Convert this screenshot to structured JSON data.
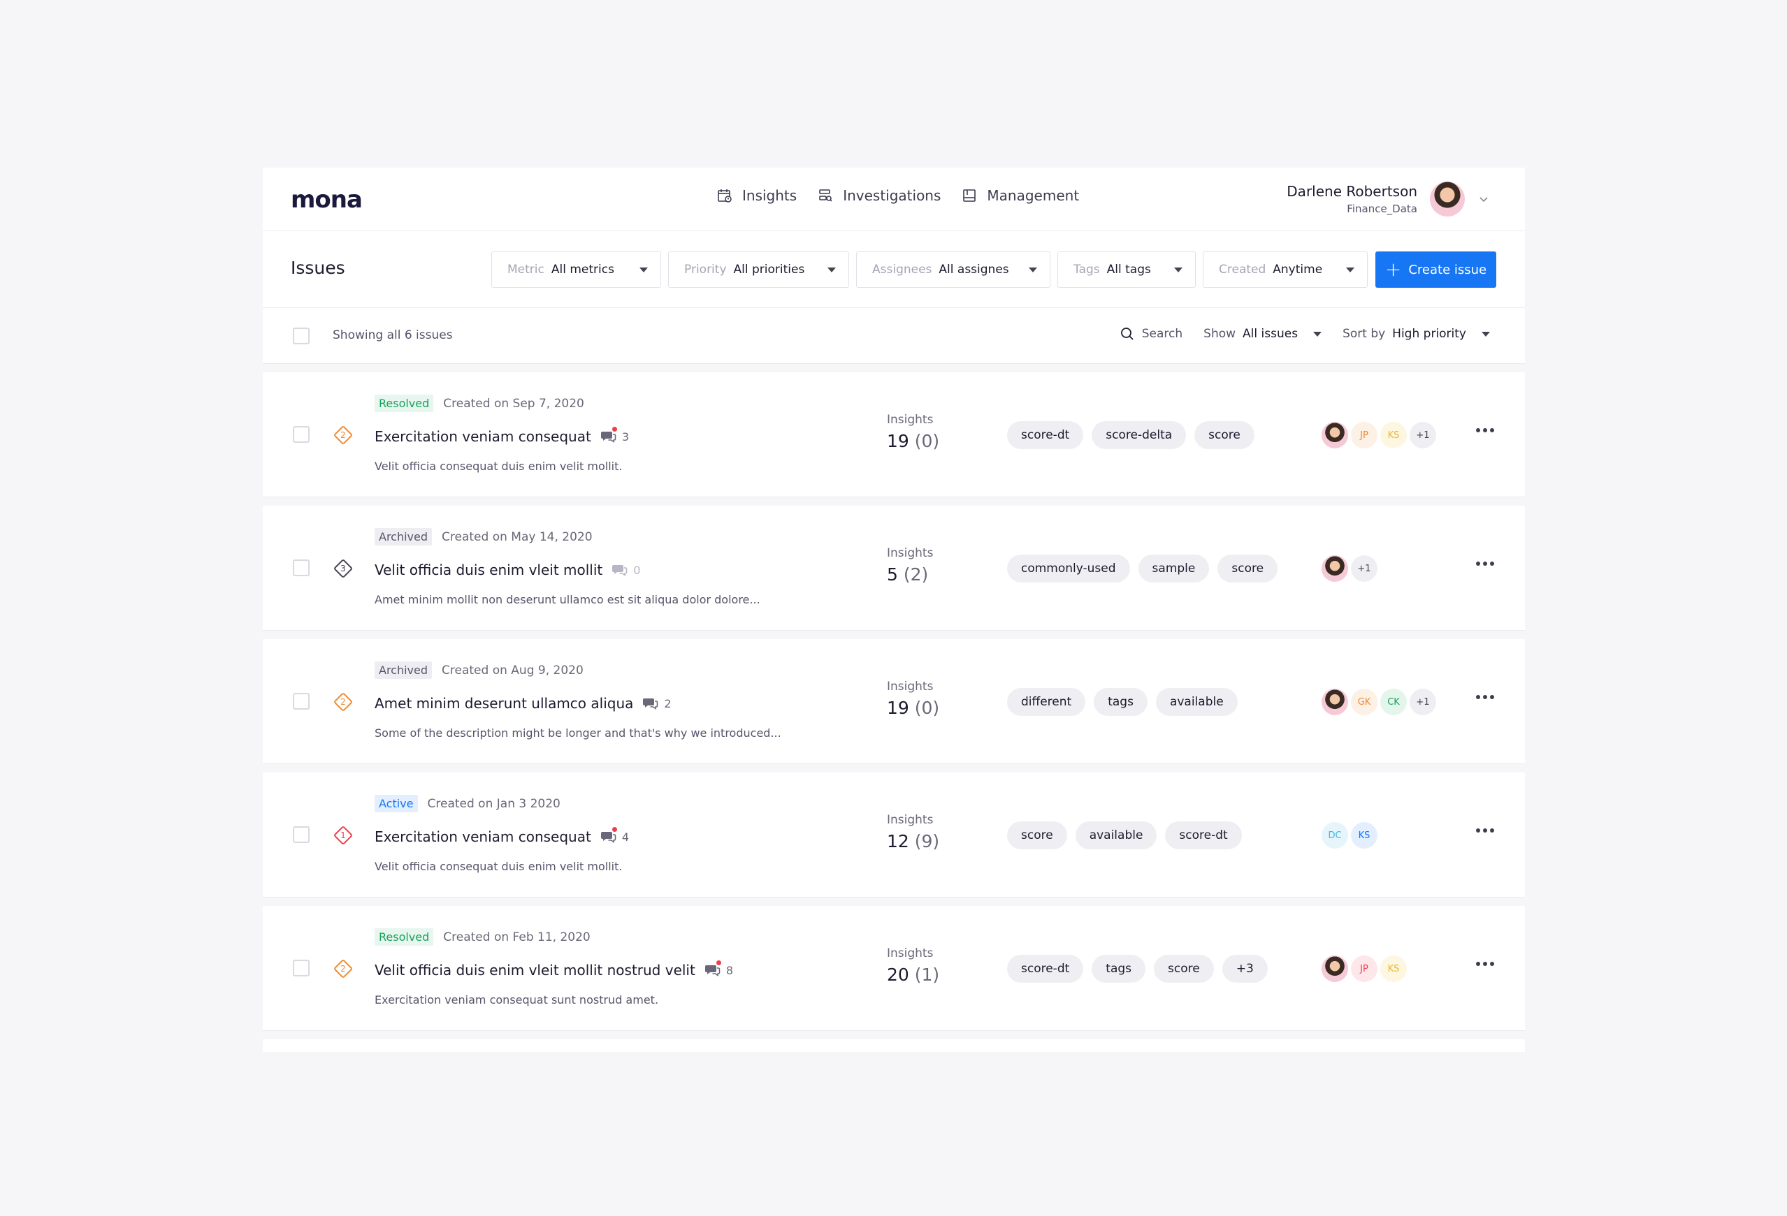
{
  "app": {
    "logo": "mona"
  },
  "nav": [
    {
      "label": "Insights",
      "icon": "insights-icon"
    },
    {
      "label": "Investigations",
      "icon": "investigations-icon"
    },
    {
      "label": "Management",
      "icon": "management-icon"
    }
  ],
  "user": {
    "name": "Darlene Robertson",
    "org": "Finance_Data"
  },
  "issues_page": {
    "title": "Issues"
  },
  "filters": [
    {
      "label": "Metric",
      "value": "All metrics"
    },
    {
      "label": "Priority",
      "value": "All priorities"
    },
    {
      "label": "Assignees",
      "value": "All assignes"
    },
    {
      "label": "Tags",
      "value": "All tags"
    },
    {
      "label": "Created",
      "value": "Anytime"
    }
  ],
  "create_button": {
    "label": "Create issue"
  },
  "listbar": {
    "showing": "Showing all 6 issues",
    "search": "Search",
    "show_prefix": "Show",
    "show_value": "All issues",
    "sort_prefix": "Sort by",
    "sort_value": "High priority"
  },
  "colors": {
    "accent": "#1676f3",
    "resolved": "#1aa05a",
    "active": "#1676f3",
    "priority_high": "#ef3d4a",
    "priority_medium": "#f08a30",
    "priority_low": "#45434f"
  },
  "issues": [
    {
      "status": "Resolved",
      "status_type": "resolved",
      "created": "Created on Sep 7, 2020",
      "priority": "2",
      "priority_color": "#f08a30",
      "title": "Exercitation veniam consequat",
      "comments": "3",
      "unread": true,
      "description": "Velit officia consequat duis enim velit mollit.",
      "insights_label": "Insights",
      "insights_total": "19",
      "insights_new": "(0)",
      "tags": [
        "score-dt",
        "score-delta",
        "score"
      ],
      "assignees": [
        {
          "kind": "photo",
          "initials": ""
        },
        {
          "kind": "initials",
          "initials": "JP",
          "fg": "#f08a30",
          "bg": "#fdf0e4"
        },
        {
          "kind": "initials",
          "initials": "KS",
          "fg": "#e8b830",
          "bg": "#fdf6e0"
        },
        {
          "kind": "initials",
          "initials": "+1",
          "fg": "#45434f",
          "bg": "#efeef3"
        }
      ]
    },
    {
      "status": "Archived",
      "status_type": "archived",
      "created": "Created on May 14, 2020",
      "priority": "3",
      "priority_color": "#45434f",
      "title": "Velit officia duis enim vleit mollit",
      "comments": "0",
      "unread": false,
      "description": "Amet minim mollit non deserunt ullamco est sit aliqua dolor dolore...",
      "insights_label": "Insights",
      "insights_total": "5",
      "insights_new": "(2)",
      "tags": [
        "commonly-used",
        "sample",
        "score"
      ],
      "assignees": [
        {
          "kind": "photo",
          "initials": ""
        },
        {
          "kind": "initials",
          "initials": "+1",
          "fg": "#45434f",
          "bg": "#efeef3"
        }
      ]
    },
    {
      "status": "Archived",
      "status_type": "archived",
      "created": "Created on Aug 9, 2020",
      "priority": "2",
      "priority_color": "#f08a30",
      "title": "Amet minim deserunt ullamco aliqua",
      "comments": "2",
      "unread": false,
      "description": "Some of the description might be longer and that's why we introduced...",
      "insights_label": "Insights",
      "insights_total": "19",
      "insights_new": "(0)",
      "tags": [
        "different",
        "tags",
        "available"
      ],
      "assignees": [
        {
          "kind": "photo",
          "initials": ""
        },
        {
          "kind": "initials",
          "initials": "GK",
          "fg": "#f08a30",
          "bg": "#fdf0e4"
        },
        {
          "kind": "initials",
          "initials": "CK",
          "fg": "#1aa05a",
          "bg": "#e4f6ec"
        },
        {
          "kind": "initials",
          "initials": "+1",
          "fg": "#45434f",
          "bg": "#efeef3"
        }
      ]
    },
    {
      "status": "Active",
      "status_type": "active",
      "created": "Created on Jan 3 2020",
      "priority": "1",
      "priority_color": "#ef3d4a",
      "title": "Exercitation veniam consequat",
      "comments": "4",
      "unread": true,
      "description": "Velit officia consequat duis enim velit mollit.",
      "insights_label": "Insights",
      "insights_total": "12",
      "insights_new": "(9)",
      "tags": [
        "score",
        "available",
        "score-dt"
      ],
      "assignees": [
        {
          "kind": "initials",
          "initials": "DC",
          "fg": "#3fb8e0",
          "bg": "#e5f5fb"
        },
        {
          "kind": "initials",
          "initials": "KS",
          "fg": "#1676f3",
          "bg": "#e3efff"
        }
      ]
    },
    {
      "status": "Resolved",
      "status_type": "resolved",
      "created": "Created on Feb 11, 2020",
      "priority": "2",
      "priority_color": "#f08a30",
      "title": "Velit officia duis enim vleit mollit nostrud velit",
      "comments": "8",
      "unread": true,
      "description": "Exercitation veniam consequat sunt nostrud amet.",
      "insights_label": "Insights",
      "insights_total": "20",
      "insights_new": "(1)",
      "tags": [
        "score-dt",
        "tags",
        "score",
        "+3"
      ],
      "assignees": [
        {
          "kind": "photo",
          "initials": ""
        },
        {
          "kind": "initials",
          "initials": "JP",
          "fg": "#ef3d4a",
          "bg": "#fde7ea"
        },
        {
          "kind": "initials",
          "initials": "KS",
          "fg": "#e8b830",
          "bg": "#fdf6e0"
        }
      ]
    }
  ]
}
